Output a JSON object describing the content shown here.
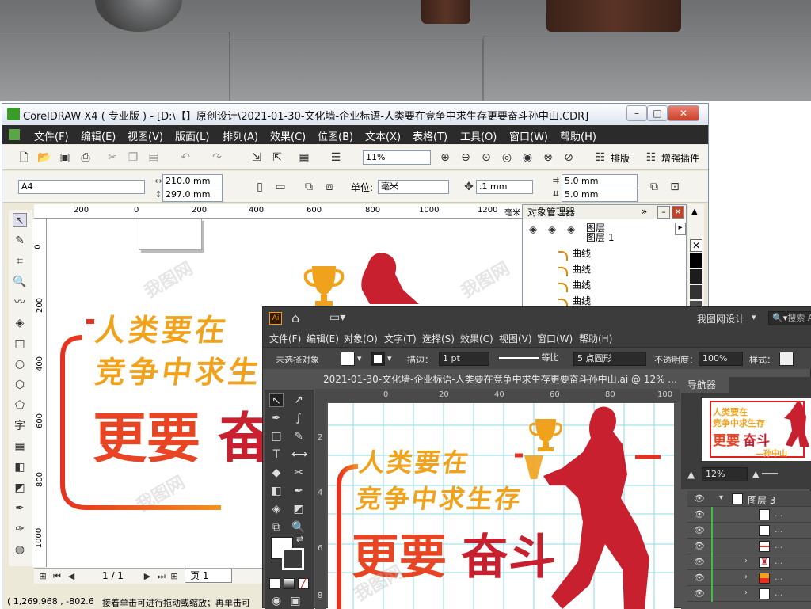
{
  "corel": {
    "title": "CorelDRAW X4 ( 专业版 ) - [D:\\【】原创设计\\2021-01-30-文化墙-企业标语-人类要在竞争中求生存更要奋斗孙中山.CDR]",
    "menu": [
      "文件(F)",
      "编辑(E)",
      "视图(V)",
      "版面(L)",
      "排列(A)",
      "效果(C)",
      "位图(B)",
      "文本(X)",
      "表格(T)",
      "工具(O)",
      "窗口(W)",
      "帮助(H)"
    ],
    "zoom": "11%",
    "typeset_label": "排版",
    "plugin_label": "增强插件",
    "page_size": "A4",
    "width": "210.0 mm",
    "height": "297.0 mm",
    "unit_label": "单位:",
    "unit": "毫米",
    "nudge": ".1 mm",
    "dup_x": "5.0 mm",
    "dup_y": "5.0 mm",
    "ruler_h": [
      "200",
      "0",
      "200",
      "400",
      "600",
      "800",
      "1000",
      "1200",
      "毫米"
    ],
    "ruler_v": [
      "0",
      "200",
      "400",
      "600",
      "800",
      "1000"
    ],
    "objmgr_title": "对象管理器",
    "layer_label": "图层",
    "layer_name": "图层 1",
    "curves": [
      "曲线",
      "曲线",
      "曲线",
      "曲线"
    ],
    "page_count": "1 / 1",
    "page_tab": "页 1",
    "status_coords": "( 1,269.968 , -802.6",
    "status_hint": "接着单击可进行拖动或缩放；再单击可"
  },
  "illustrator": {
    "workspace": "我图网设计",
    "search_placeholder": "搜索 Ad",
    "menu": [
      "文件(F)",
      "编辑(E)",
      "对象(O)",
      "文字(T)",
      "选择(S)",
      "效果(C)",
      "视图(V)",
      "窗口(W)",
      "帮助(H)"
    ],
    "no_selection": "未选择对象",
    "stroke_label": "描边：",
    "stroke_value": "1 pt",
    "ratio_label": "等比",
    "brush_label": "5 点圆形",
    "opacity_label": "不透明度：",
    "opacity_value": "100%",
    "style_label": "样式：",
    "doc_tab": "2021-01-30-文化墙-企业标语-人类要在竞争中求生存更要奋斗孙中山.ai @ 12% ...",
    "ruler_h": [
      "0",
      "20",
      "40",
      "60",
      "80",
      "100"
    ],
    "ruler_v": [
      "2",
      "4",
      "6",
      "8"
    ],
    "navigator_title": "导航器",
    "nav_zoom": "12%",
    "layer_name": "图层 3",
    "layer_rows": [
      "...",
      "...",
      "...",
      "...",
      "...",
      "..."
    ]
  },
  "artwork": {
    "line1": "人类要在",
    "line2": "竞争中求生存",
    "line3a": "更要",
    "line3b": "奋斗",
    "author": "孙中山"
  },
  "watermark": "我图网",
  "colors": {
    "orange": "#f0a21c",
    "red": "#c8202e",
    "gradient_start": "#e7301f",
    "gradient_end": "#f39221"
  }
}
